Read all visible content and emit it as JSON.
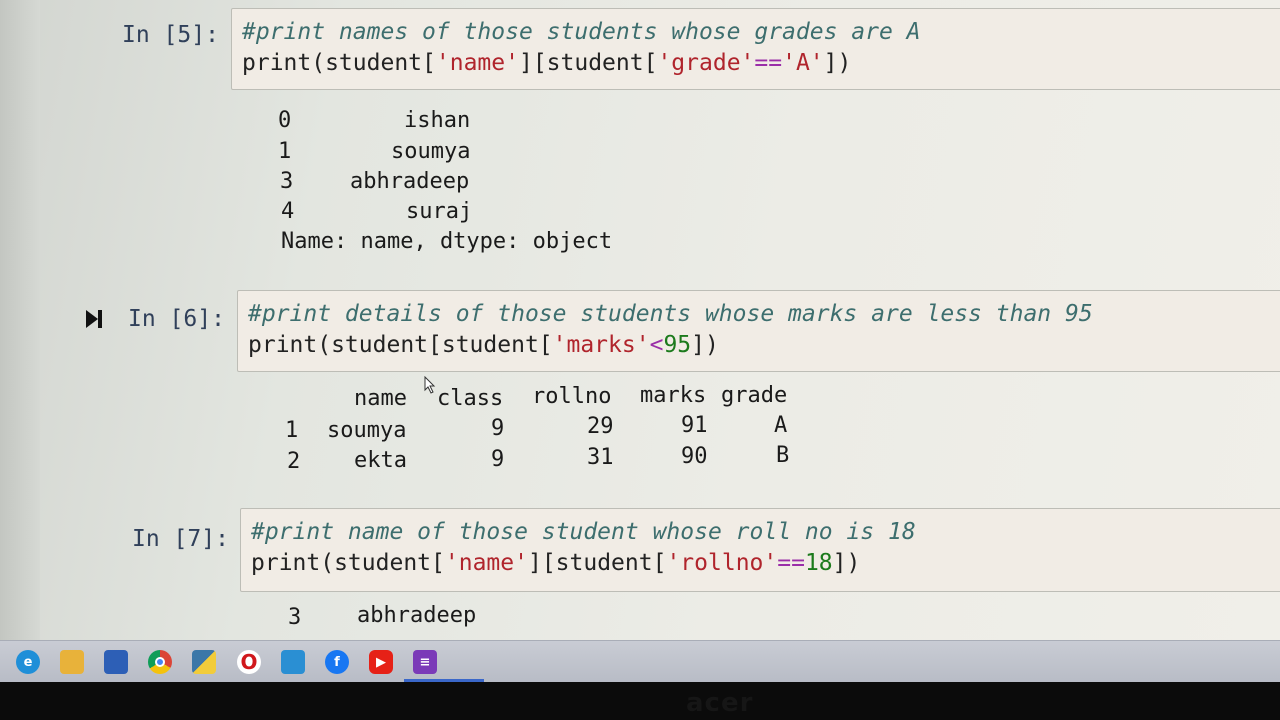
{
  "cells": [
    {
      "prompt": "In [5]:",
      "comment": "#print names of those students whose grades are A",
      "code": {
        "p1": "print(student[",
        "s1": "'name'",
        "p2": "][student[",
        "s2": "'grade'",
        "op": "==",
        "s3": "'A'",
        "p3": "])"
      },
      "output": {
        "rows": [
          {
            "index": "0",
            "value": "ishan"
          },
          {
            "index": "1",
            "value": "soumya"
          },
          {
            "index": "3",
            "value": "abhradeep"
          },
          {
            "index": "4",
            "value": "suraj"
          }
        ],
        "footer": "Name: name, dtype: object"
      }
    },
    {
      "prompt": "In [6]:",
      "comment": "#print details of those students whose marks are less than 95",
      "code": {
        "p1": "print(student[student[",
        "s1": "'marks'",
        "op": "<",
        "n1": "95",
        "p2": "])"
      },
      "table": {
        "columns": [
          "name",
          "class",
          "rollno",
          "marks",
          "grade"
        ],
        "rows": [
          {
            "index": "1",
            "cells": [
              "soumya",
              "9",
              "29",
              "91",
              "A"
            ]
          },
          {
            "index": "2",
            "cells": [
              "ekta",
              "9",
              "31",
              "90",
              "B"
            ]
          }
        ]
      }
    },
    {
      "prompt": "In [7]:",
      "comment": "#print name of those student whose roll no is 18",
      "code": {
        "p1": "print(student[",
        "s1": "'name'",
        "p2": "][student[",
        "s2": "'rollno'",
        "op": "==",
        "n1": "18",
        "p3": "])"
      },
      "output": {
        "rows": [
          {
            "index": "3",
            "value": "abhradeep"
          }
        ]
      }
    }
  ],
  "taskbar": {
    "icons": [
      "edge-icon",
      "file-explorer-icon",
      "store-icon",
      "chrome-icon",
      "python-icon",
      "opera-icon",
      "weather-icon",
      "facebook-icon",
      "youtube-icon",
      "onenote-icon"
    ]
  },
  "bezel": {
    "brand": "acer"
  }
}
